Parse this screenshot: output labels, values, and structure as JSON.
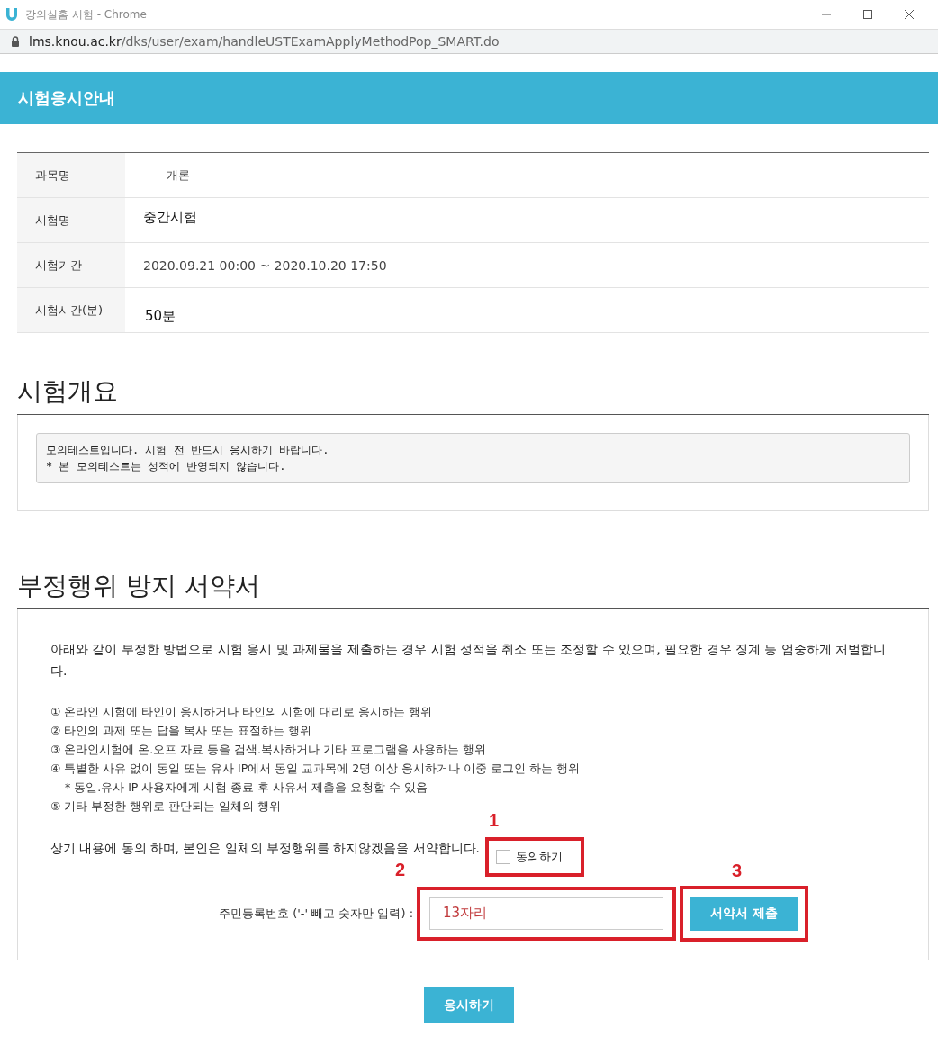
{
  "window": {
    "title": "강의실홈 시험 - Chrome",
    "url_host": "lms.knou.ac.kr",
    "url_path": "/dks/user/exam/handleUSTExamApplyMethodPop_SMART.do"
  },
  "header": {
    "title": "시험응시안내"
  },
  "info_table": [
    {
      "label": "과목명",
      "value": "개론",
      "kind": "indented"
    },
    {
      "label": "시험명",
      "value": "중간시험",
      "kind": "large"
    },
    {
      "label": "시험기간",
      "value": "2020.09.21 00:00 ~ 2020.10.20 17:50",
      "kind": "plain"
    },
    {
      "label": "시험시간(분)",
      "value": "50분",
      "kind": "low"
    }
  ],
  "overview": {
    "heading": "시험개요",
    "lines": [
      "모의테스트입니다. 시험 전 반드시 응시하기 바랍니다.",
      "* 본 모의테스트는 성적에 반영되지 않습니다."
    ]
  },
  "pledge": {
    "heading": "부정행위 방지 서약서",
    "intro": "아래와 같이 부정한 방법으로 시험 응시 및 과제물을 제출하는 경우 시험 성적을 취소 또는 조정할 수 있으며, 필요한 경우 징계 등 엄중하게 처벌합니다.",
    "items": [
      {
        "text": "① 온라인 시험에 타인이 응시하거나 타인의 시험에 대리로 응시하는 행위",
        "kind": "item"
      },
      {
        "text": "② 타인의 과제 또는 답을 복사 또는 표절하는 행위",
        "kind": "item"
      },
      {
        "text": "③ 온라인시험에 온.오프 자료 등을 검색.복사하거나 기타 프로그램을 사용하는 행위",
        "kind": "item"
      },
      {
        "text": "④ 특별한 사유 없이 동일 또는 유사 IP에서 동일 교과목에 2명 이상 응시하거나 이중 로그인 하는 행위",
        "kind": "item"
      },
      {
        "text": "* 동일.유사 IP 사용자에게 시험 종료 후 사유서 제출을 요청할 수 있음",
        "kind": "note"
      },
      {
        "text": "⑤ 기타 부정한 행위로 판단되는 일체의 행위",
        "kind": "item"
      }
    ],
    "statement": "상기 내용에 동의 하며, 본인은 일체의 부정행위를 하지않겠음을 서약합니다.",
    "agree": {
      "label": "동의하기",
      "checked": false
    },
    "id_label": "주민등록번호 ('-' 빼고 숫자만 입력) :",
    "id_value": "13자리",
    "submit_button": "서약서 제출"
  },
  "callouts": [
    "1",
    "2",
    "3"
  ],
  "start_button": "응시하기"
}
